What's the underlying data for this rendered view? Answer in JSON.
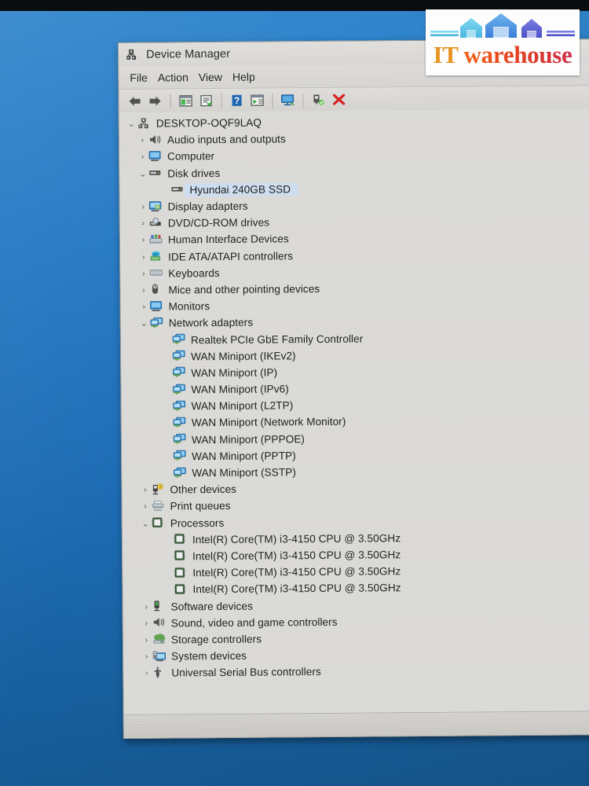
{
  "window": {
    "title": "Device Manager",
    "title_icon": "device-manager-icon",
    "menu": [
      {
        "label": "File"
      },
      {
        "label": "Action"
      },
      {
        "label": "View"
      },
      {
        "label": "Help"
      }
    ],
    "toolbar": [
      {
        "name": "back-arrow-icon",
        "label": "Back"
      },
      {
        "name": "forward-arrow-icon",
        "label": "Forward"
      },
      {
        "name": "separator",
        "label": ""
      },
      {
        "name": "show-hide-console-tree-icon",
        "label": "Show/Hide Console Tree"
      },
      {
        "name": "properties-icon",
        "label": "Properties"
      },
      {
        "name": "separator",
        "label": ""
      },
      {
        "name": "help-icon",
        "label": "Help"
      },
      {
        "name": "update-driver-icon",
        "label": "Update Driver Software"
      },
      {
        "name": "separator",
        "label": ""
      },
      {
        "name": "scan-for-hardware-changes-icon",
        "label": "Scan for hardware changes"
      },
      {
        "name": "separator",
        "label": ""
      },
      {
        "name": "enable-device-icon",
        "label": "Enable device"
      },
      {
        "name": "uninstall-device-icon",
        "label": "Uninstall device"
      }
    ]
  },
  "tree": {
    "root": {
      "label": "DESKTOP-OQF9LAQ",
      "icon": "computer-root-icon",
      "state": "expanded",
      "level": 0
    },
    "nodes": [
      {
        "label": "Audio inputs and outputs",
        "icon": "speaker-icon",
        "state": "collapsed",
        "level": 1
      },
      {
        "label": "Computer",
        "icon": "monitor-icon",
        "state": "collapsed",
        "level": 1
      },
      {
        "label": "Disk drives",
        "icon": "disk-drive-icon",
        "state": "expanded",
        "level": 1
      },
      {
        "label": "Hyundai 240GB SSD",
        "icon": "disk-drive-icon",
        "state": "leaf",
        "level": 2,
        "selected": true
      },
      {
        "label": "Display adapters",
        "icon": "display-adapter-icon",
        "state": "collapsed",
        "level": 1
      },
      {
        "label": "DVD/CD-ROM drives",
        "icon": "dvd-drive-icon",
        "state": "collapsed",
        "level": 1
      },
      {
        "label": "Human Interface Devices",
        "icon": "hid-icon",
        "state": "collapsed",
        "level": 1
      },
      {
        "label": "IDE ATA/ATAPI controllers",
        "icon": "ide-controller-icon",
        "state": "collapsed",
        "level": 1
      },
      {
        "label": "Keyboards",
        "icon": "keyboard-icon",
        "state": "collapsed",
        "level": 1
      },
      {
        "label": "Mice and other pointing devices",
        "icon": "mouse-icon",
        "state": "collapsed",
        "level": 1
      },
      {
        "label": "Monitors",
        "icon": "monitor-icon",
        "state": "collapsed",
        "level": 1
      },
      {
        "label": "Network adapters",
        "icon": "network-adapter-icon",
        "state": "expanded",
        "level": 1
      },
      {
        "label": "Realtek PCIe GbE Family Controller",
        "icon": "network-adapter-icon",
        "state": "leaf",
        "level": 2
      },
      {
        "label": "WAN Miniport (IKEv2)",
        "icon": "network-adapter-icon",
        "state": "leaf",
        "level": 2
      },
      {
        "label": "WAN Miniport (IP)",
        "icon": "network-adapter-icon",
        "state": "leaf",
        "level": 2
      },
      {
        "label": "WAN Miniport (IPv6)",
        "icon": "network-adapter-icon",
        "state": "leaf",
        "level": 2
      },
      {
        "label": "WAN Miniport (L2TP)",
        "icon": "network-adapter-icon",
        "state": "leaf",
        "level": 2
      },
      {
        "label": "WAN Miniport (Network Monitor)",
        "icon": "network-adapter-icon",
        "state": "leaf",
        "level": 2
      },
      {
        "label": "WAN Miniport (PPPOE)",
        "icon": "network-adapter-icon",
        "state": "leaf",
        "level": 2
      },
      {
        "label": "WAN Miniport (PPTP)",
        "icon": "network-adapter-icon",
        "state": "leaf",
        "level": 2
      },
      {
        "label": "WAN Miniport (SSTP)",
        "icon": "network-adapter-icon",
        "state": "leaf",
        "level": 2
      },
      {
        "label": "Other devices",
        "icon": "other-devices-icon",
        "state": "collapsed",
        "level": 1
      },
      {
        "label": "Print queues",
        "icon": "printer-icon",
        "state": "collapsed",
        "level": 1
      },
      {
        "label": "Processors",
        "icon": "processor-icon",
        "state": "expanded",
        "level": 1
      },
      {
        "label": "Intel(R) Core(TM) i3-4150 CPU @ 3.50GHz",
        "icon": "processor-icon",
        "state": "leaf",
        "level": 2
      },
      {
        "label": "Intel(R) Core(TM) i3-4150 CPU @ 3.50GHz",
        "icon": "processor-icon",
        "state": "leaf",
        "level": 2
      },
      {
        "label": "Intel(R) Core(TM) i3-4150 CPU @ 3.50GHz",
        "icon": "processor-icon",
        "state": "leaf",
        "level": 2
      },
      {
        "label": "Intel(R) Core(TM) i3-4150 CPU @ 3.50GHz",
        "icon": "processor-icon",
        "state": "leaf",
        "level": 2
      },
      {
        "label": "Software devices",
        "icon": "software-device-icon",
        "state": "collapsed",
        "level": 1
      },
      {
        "label": "Sound, video and game controllers",
        "icon": "speaker-icon",
        "state": "collapsed",
        "level": 1
      },
      {
        "label": "Storage controllers",
        "icon": "storage-controller-icon",
        "state": "collapsed",
        "level": 1
      },
      {
        "label": "System devices",
        "icon": "system-device-icon",
        "state": "collapsed",
        "level": 1
      },
      {
        "label": "Universal Serial Bus controllers",
        "icon": "usb-controller-icon",
        "state": "collapsed",
        "level": 1
      }
    ],
    "glyphs": {
      "collapsed": "›",
      "expanded": "⌄"
    }
  },
  "logo": {
    "text_it": "IT",
    "text_warehouse": " warehouse",
    "houses": [
      "house-light-blue",
      "house-medium-blue",
      "house-purple-blue"
    ],
    "colors": {
      "it": "#e8941f",
      "warehouse_start": "#ef6a1e",
      "warehouse_end": "#cf2f4a",
      "house_left": "#5fc8ea",
      "house_center": "#4a8fe0",
      "house_right": "#5a5fd0"
    }
  },
  "desktop": {
    "background_color": "#1d76c6",
    "top_strip_color": "#0a0d10"
  }
}
